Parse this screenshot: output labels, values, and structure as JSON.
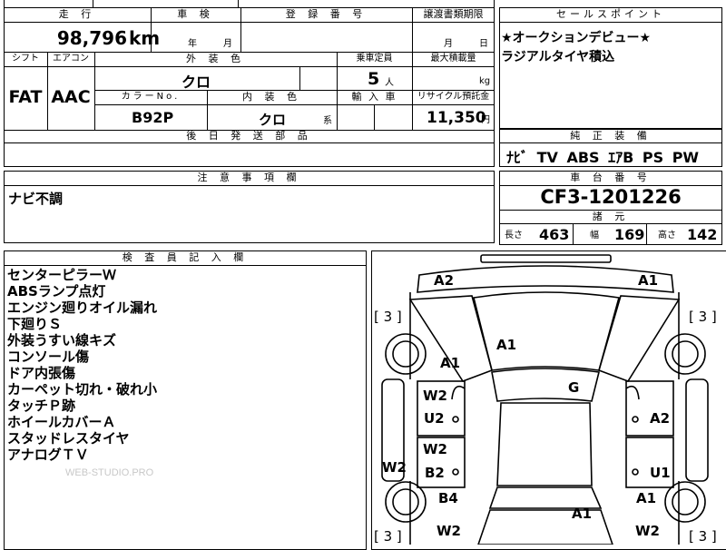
{
  "top_cut": {
    "a": "",
    "b": ""
  },
  "mileage": {
    "header": "走 行",
    "value": "98,796",
    "unit": "km"
  },
  "inspection": {
    "header": "車 検",
    "year": "年",
    "month": "月"
  },
  "registration": {
    "header": "登 録 番 号",
    "value": ""
  },
  "transfer_deadline": {
    "header": "譲渡書類期限",
    "month": "月",
    "day": "日"
  },
  "selling_points": {
    "header": "セールスポイント",
    "lines": [
      "★オークションデビュー★",
      "ラジアルタイヤ積込"
    ]
  },
  "shift": {
    "header": "シフト",
    "value": "FAT"
  },
  "aircon": {
    "header": "エアコン",
    "value": "AAC"
  },
  "exterior_color": {
    "header": "外 装 色",
    "value": "クロ"
  },
  "capacity": {
    "header": "乗車定員",
    "value": "5",
    "unit": "人"
  },
  "max_load": {
    "header": "最大積載量",
    "value": "",
    "unit": "kg"
  },
  "color_no": {
    "header": "カラーNo.",
    "value": "B92P"
  },
  "interior_color": {
    "header": "内 装 色",
    "value": "クロ",
    "suffix": "系"
  },
  "import_car": {
    "header": "輸 入 車",
    "value": ""
  },
  "recycle": {
    "header": "リサイクル預託金",
    "value": "11,350",
    "unit": "円"
  },
  "later_parts": {
    "header": "後 日 発 送 部 品",
    "value": ""
  },
  "equipment": {
    "header": "純 正 装 備",
    "value": "ﾅﾋﾞ TV ABS ｴｱB PS PW"
  },
  "caution": {
    "header": "注 意 事 項 欄",
    "value": "ナビ不調"
  },
  "chassis": {
    "header": "車 台 番 号",
    "value": "CF3-1201226"
  },
  "dims": {
    "header": "諸 元",
    "length_label": "長さ",
    "length": "463",
    "width_label": "幅",
    "width": "169",
    "height_label": "高さ",
    "height": "142"
  },
  "inspector": {
    "header": "検 査 員 記 入 欄",
    "notes": [
      "センターピラーＷ",
      "ABSランプ点灯",
      "エンジン廻りオイル漏れ",
      "下廻りＳ",
      "外装うすい線キズ",
      "コンソール傷",
      "ドア内張傷",
      "カーペット切れ・破れ小",
      "タッチＰ跡",
      "ホイールカバーＡ",
      "スタッドレスタイヤ",
      "アナログＴＶ"
    ],
    "watermark": "WEB-STUDIO.PRO"
  },
  "diagram": {
    "tire_marks": [
      "[ 3 ]",
      "[ 3 ]",
      "[ 3 ]",
      "[ 3 ]"
    ],
    "damage": [
      "A2",
      "A1",
      "A1",
      "A1",
      "G",
      "W2",
      "U2",
      "A2",
      "W2",
      "B2",
      "U1",
      "W2",
      "B4",
      "A1",
      "A1",
      "W2",
      "W2"
    ]
  }
}
